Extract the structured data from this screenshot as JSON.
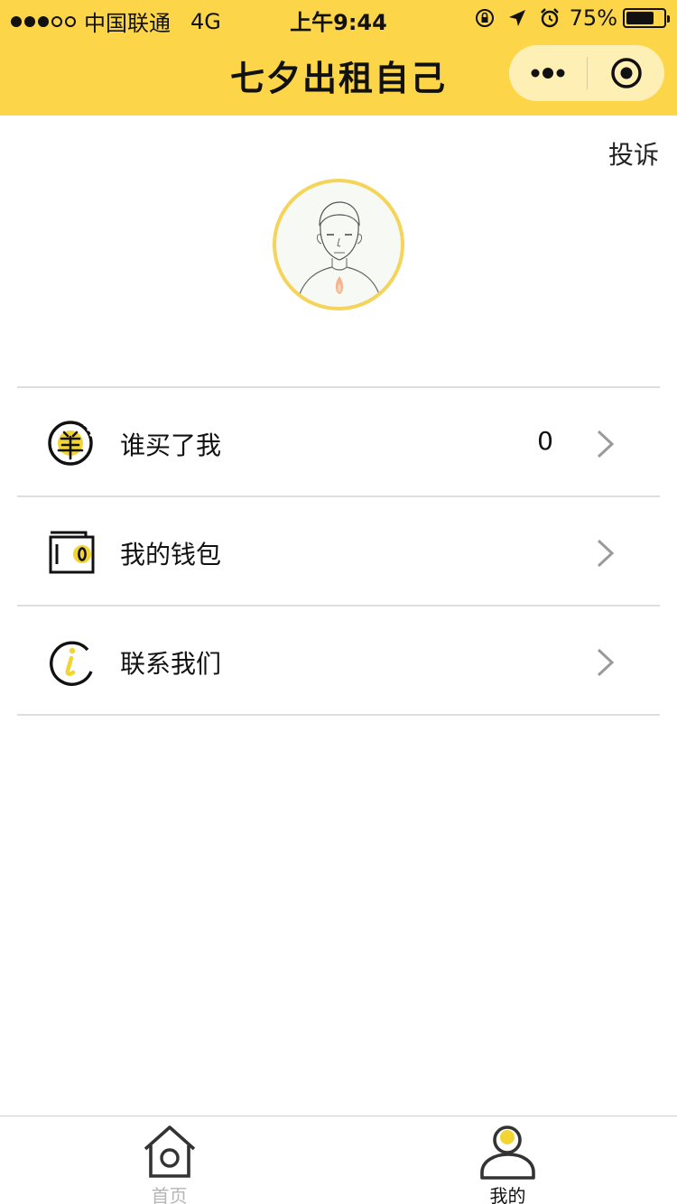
{
  "status_bar": {
    "carrier": "中国联通",
    "network": "4G",
    "time": "上午9:44",
    "battery_percent": "75%",
    "battery_level": 0.75,
    "signal_bars_filled": 3,
    "signal_bars_total": 5
  },
  "nav": {
    "title": "七夕出租自己"
  },
  "complaint_label": "投诉",
  "menu": {
    "items": [
      {
        "label": "谁买了我",
        "value": "0",
        "icon": "yuan-coin-icon"
      },
      {
        "label": "我的钱包",
        "icon": "wallet-icon"
      },
      {
        "label": "联系我们",
        "icon": "info-icon"
      }
    ]
  },
  "tabbar": {
    "tabs": [
      {
        "label": "首页",
        "icon": "home-icon",
        "active": false
      },
      {
        "label": "我的",
        "icon": "profile-icon",
        "active": true
      }
    ]
  },
  "colors": {
    "accent": "#FCD648",
    "avatar_border": "#F4D45A",
    "icon_yellow": "#F2D533",
    "divider": "#dedede",
    "inactive_tab": "#b5b5b5"
  }
}
